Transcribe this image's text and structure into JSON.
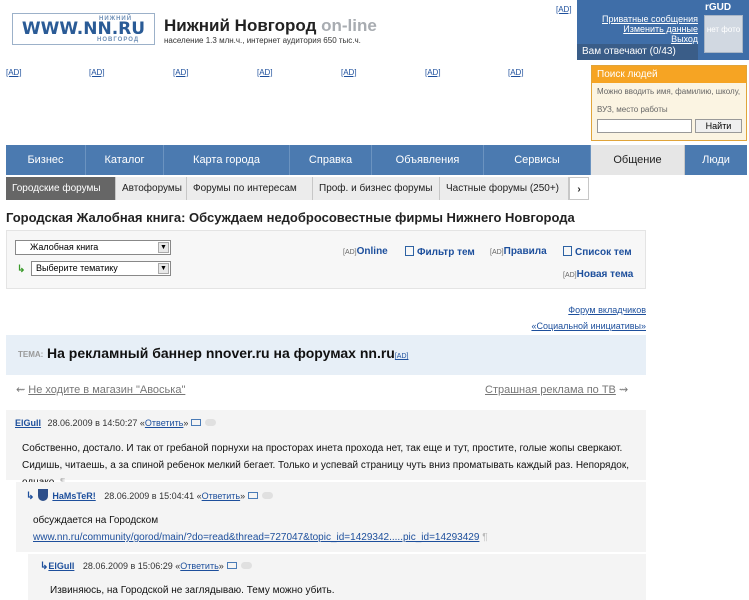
{
  "header": {
    "logo_text": "WWW.NN.RU",
    "logo_top": "НИЖНИЙ",
    "logo_bottom": "НОВГОРОД",
    "city": "Нижний Новгород",
    "online": "on-line",
    "subtitle": "население 1.3 млн.ч., интернет аудитория 650 тыс.ч.",
    "ad_top": "[AD]"
  },
  "user": {
    "name": "rGUD",
    "links": [
      "Приватные сообщения",
      "Изменить данные",
      "Выход"
    ],
    "photo": "нет фото",
    "answers": "Вам отвечают (0/43)"
  },
  "ads": [
    "[AD]",
    "[AD]",
    "[AD]",
    "[AD]",
    "[AD]",
    "[AD]",
    "[AD]"
  ],
  "search": {
    "title": "Поиск людей",
    "hint": "Можно вводить имя, фамилию, школу, ВУЗ, место работы",
    "button": "Найти"
  },
  "nav": [
    "Бизнес",
    "Каталог",
    "Карта города",
    "Справка",
    "Объявления",
    "Сервисы",
    "Общение",
    "Люди"
  ],
  "subnav": [
    "Городские форумы",
    "Автофорумы",
    "Форумы по интересам",
    "Проф. и бизнес форумы",
    "Частные форумы (250+)"
  ],
  "page_title": "Городская Жалобная книга: Обсуждаем недобросовестные фирмы Нижнего Новгорода",
  "controls": {
    "forum_select": "Жалобная книга",
    "topic_select": "Выберите тематику",
    "ad": "[AD]",
    "online": "Online",
    "filter": "Фильтр тем",
    "rules": "Правила",
    "topics_list": "Список тем",
    "new_topic": "Новая тема"
  },
  "right_links": [
    "Форум вкладчиков",
    "«Социальной инициативы»"
  ],
  "topic": {
    "label": "ТЕМА:",
    "title": "На рекламный баннер nnover.ru на форумах nn.ru",
    "ad": "[AD]"
  },
  "prev_topic": "Не ходите в магазин \"Авоська\"",
  "next_topic": "Страшная реклама по ТВ",
  "posts": [
    {
      "author": "ElGull",
      "date": "28.06.2009 в 14:50:27",
      "reply": "Ответить",
      "text": "Собственно, достало. И так от гребаной порнухи на просторах инета прохода нет, так еще и тут, простите, голые жопы сверкают. Сидишь, читаешь, а за спиной ребенок мелкий бегает. Только и успевай страницу чуть вниз проматывать каждый раз. Непорядок, однако."
    },
    {
      "author": "HaMsTeR!",
      "date": "28.06.2009 в 15:04:41",
      "reply": "Ответить",
      "text": "обсуждается на Городском",
      "link": "www.nn.ru/community/gorod/main/?do=read&thread=727047&topic_id=1429342.....pic_id=14293429"
    },
    {
      "author": "ElGull",
      "date": "28.06.2009 в 15:06:29",
      "reply": "Ответить",
      "text": "Извиняюсь, на Городской не заглядываю. Тему можно убить."
    }
  ],
  "pilcrow": "¶"
}
